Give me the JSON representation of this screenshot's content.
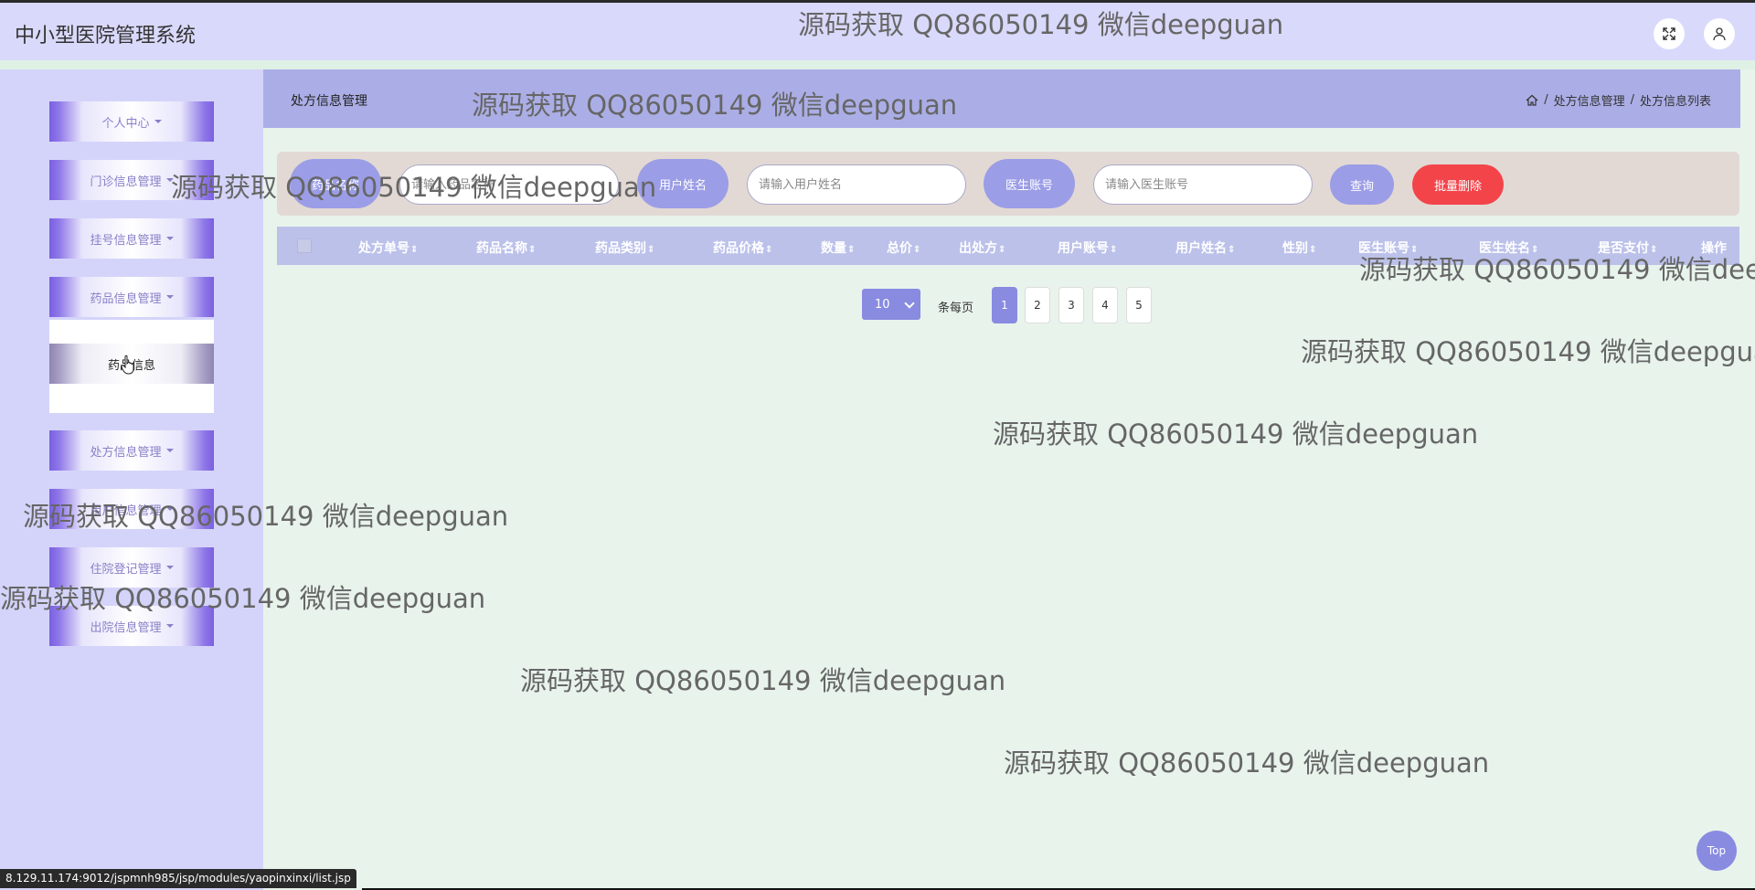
{
  "header": {
    "app_title": "中小型医院管理系统",
    "fullscreen_icon": "fullscreen-icon",
    "user_icon": "user-icon"
  },
  "sidebar": {
    "items": [
      {
        "label": "个人中心"
      },
      {
        "label": "门诊信息管理"
      },
      {
        "label": "挂号信息管理"
      },
      {
        "label": "药品信息管理"
      },
      {
        "label": "处方信息管理"
      },
      {
        "label": "用户信息管理"
      },
      {
        "label": "住院登记管理"
      },
      {
        "label": "出院信息管理"
      }
    ],
    "submenu_item": "药品信息"
  },
  "content": {
    "title": "处方信息管理",
    "breadcrumb": [
      "处方信息管理",
      "处方信息列表"
    ],
    "breadcrumb_separator": "/"
  },
  "search": {
    "field1_label": "药品名称",
    "field1_placeholder": "请输入药品名称",
    "field2_label": "用户姓名",
    "field2_placeholder": "请输入用户姓名",
    "field3_label": "医生账号",
    "field3_placeholder": "请输入医生账号",
    "query_button": "查询",
    "batch_delete_button": "批量删除"
  },
  "table": {
    "columns": [
      "处方单号",
      "药品名称",
      "药品类别",
      "药品价格",
      "数量",
      "总价",
      "出处方",
      "用户账号",
      "用户姓名",
      "性别",
      "医生账号",
      "医生姓名",
      "是否支付",
      "操作"
    ],
    "sort_symbol": "⇕"
  },
  "pagination": {
    "page_size": "10",
    "per_page_label": "条每页",
    "pages": [
      "1",
      "2",
      "3",
      "4",
      "5"
    ],
    "current": "1"
  },
  "watermark": "源码获取 QQ86050149 微信deepguan",
  "status_url": "8.129.11.174:9012/jspmnh985/jsp/modules/yaopinxinxi/list.jsp",
  "top_button": "Top"
}
